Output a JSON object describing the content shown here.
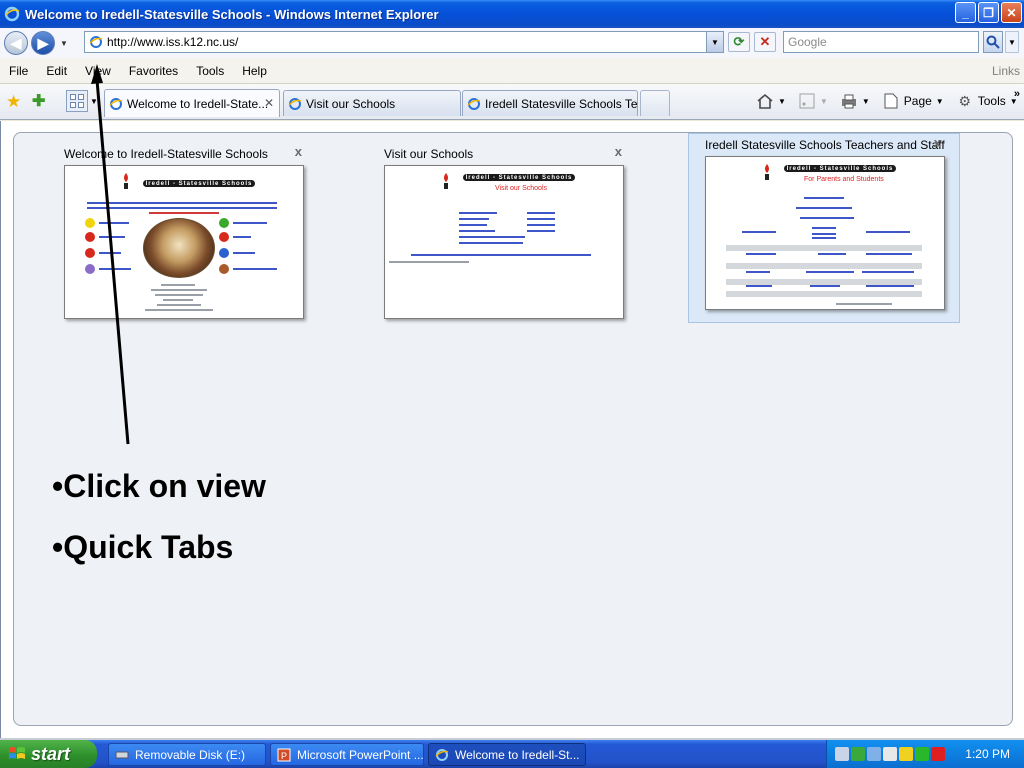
{
  "window": {
    "title": "Welcome to Iredell-Statesville Schools - Windows Internet Explorer"
  },
  "address_bar": {
    "url": "http://www.iss.k12.nc.us/",
    "search_placeholder": "Google"
  },
  "menu": {
    "items": [
      "File",
      "Edit",
      "View",
      "Favorites",
      "Tools",
      "Help"
    ],
    "links_label": "Links"
  },
  "tabs": [
    {
      "label": "Welcome to Iredell-State...",
      "active": true
    },
    {
      "label": "Visit our Schools",
      "active": false
    },
    {
      "label": "Iredell Statesville Schools Te...",
      "active": false
    }
  ],
  "command_bar": {
    "page_label": "Page",
    "tools_label": "Tools"
  },
  "quick_tabs": [
    {
      "title": "Welcome to Iredell-Statesville Schools",
      "selected": false
    },
    {
      "title": "Visit our Schools",
      "selected": false,
      "heading": "Visit our Schools"
    },
    {
      "title": "Iredell Statesville Schools Teachers and Staff",
      "selected": true,
      "heading": "For Parents and Students"
    }
  ],
  "thumb_banner": "Iredell - Statesville Schools",
  "annotation": {
    "bullets": [
      "•Click on view",
      "•Quick Tabs"
    ]
  },
  "taskbar": {
    "start_label": "start",
    "tasks": [
      {
        "label": "Removable Disk (E:)",
        "active": false
      },
      {
        "label": "Microsoft PowerPoint ...",
        "active": false
      },
      {
        "label": "Welcome to Iredell-St...",
        "active": true
      }
    ],
    "clock": "1:20 PM"
  },
  "colors": {
    "titlebar": "#0550d8",
    "taskbar": "#2352c9",
    "start": "#2c8e2a",
    "tray": "#0d7fe0",
    "panel": "#eef1f6",
    "selected_thumb": "#dbe8f7"
  }
}
